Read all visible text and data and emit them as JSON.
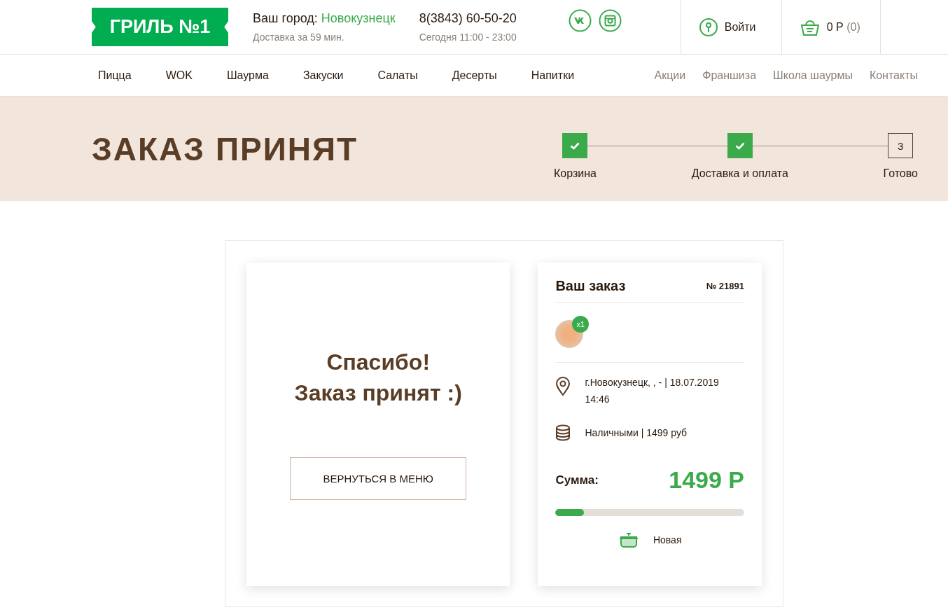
{
  "header": {
    "logo": "ГРИЛЬ №1",
    "city_label": "Ваш город:",
    "city": "Новокузнецк",
    "delivery": "Доставка за 59 мин.",
    "phone": "8(3843) 60-50-20",
    "hours": "Сегодня 11:00 - 23:00",
    "login": "Войти",
    "cart_total": "0 Р",
    "cart_count": "(0)"
  },
  "nav": [
    {
      "label": "Пицца",
      "kind": "main"
    },
    {
      "label": "WOK",
      "kind": "main"
    },
    {
      "label": "Шаурма",
      "kind": "main"
    },
    {
      "label": "Закуски",
      "kind": "main"
    },
    {
      "label": "Салаты",
      "kind": "main"
    },
    {
      "label": "Десерты",
      "kind": "main"
    },
    {
      "label": "Напитки",
      "kind": "main"
    },
    {
      "label": "Акции",
      "kind": "secondary"
    },
    {
      "label": "Франшиза",
      "kind": "secondary"
    },
    {
      "label": "Школа шаурмы",
      "kind": "secondary"
    },
    {
      "label": "Контакты",
      "kind": "secondary"
    }
  ],
  "banner": {
    "title": "ЗАКАЗ ПРИНЯТ",
    "steps": [
      {
        "label": "Корзина",
        "done": true
      },
      {
        "label": "Доставка и оплата",
        "done": true
      },
      {
        "label": "Готово",
        "number": "3",
        "done": false
      }
    ]
  },
  "thanks": {
    "lines": [
      "Спасибо!",
      "Заказ принят :)"
    ],
    "button": "ВЕРНУТЬСЯ В МЕНЮ"
  },
  "order": {
    "title": "Ваш заказ",
    "number": "№ 21891",
    "items": [
      {
        "quantity": "x1"
      }
    ],
    "address": "г.Новокузнецк, , - | 18.07.2019 14:46",
    "payment": "Наличными | 1499 руб",
    "sum_label": "Сумма:",
    "sum": "1499 Р",
    "status": {
      "level": 0.15,
      "label": "Новая"
    }
  }
}
